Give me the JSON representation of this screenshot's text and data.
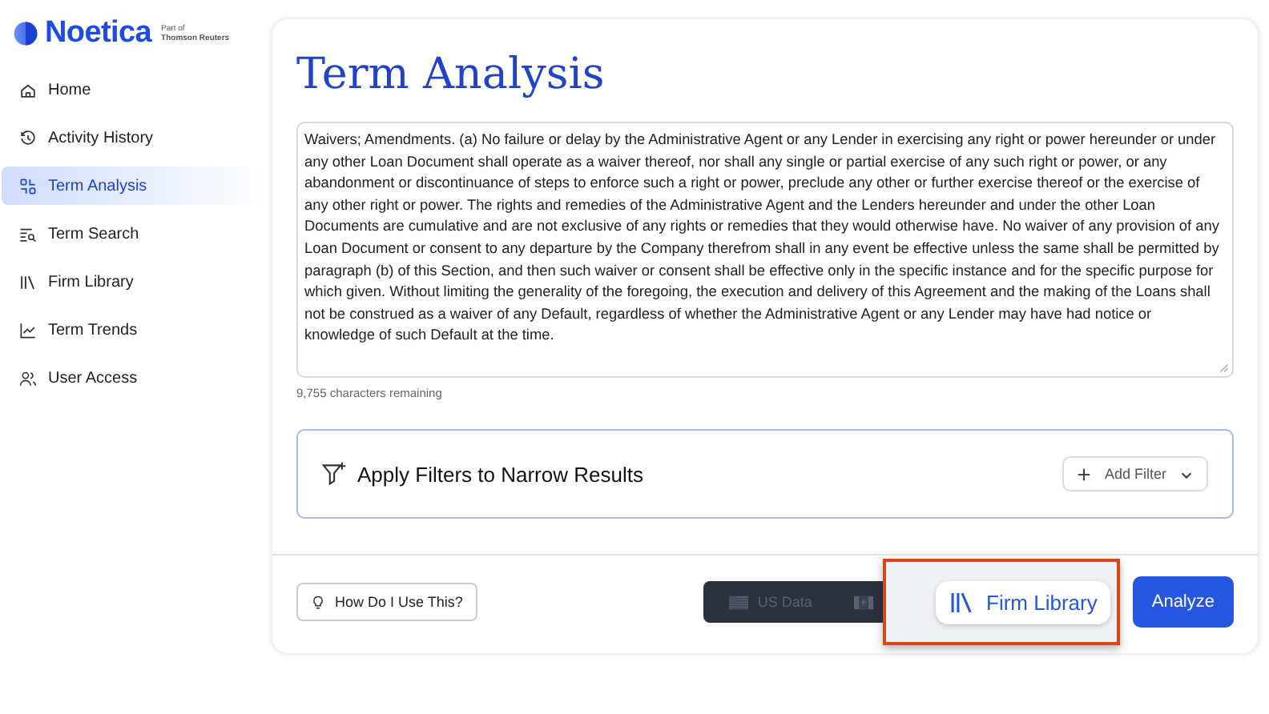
{
  "logo": {
    "name": "Noetica",
    "tagline_1": "Part of",
    "tagline_2": "Thomson Reuters"
  },
  "sidebar": {
    "items": [
      {
        "label": "Home",
        "selected": false
      },
      {
        "label": "Activity History",
        "selected": false
      },
      {
        "label": "Term Analysis",
        "selected": true
      },
      {
        "label": "Term Search",
        "selected": false
      },
      {
        "label": "Firm Library",
        "selected": false
      },
      {
        "label": "Term Trends",
        "selected": false
      },
      {
        "label": "User Access",
        "selected": false
      }
    ]
  },
  "page": {
    "title": "Term Analysis",
    "text_input": {
      "value": "Waivers; Amendments. (a) No failure or delay by the Administrative Agent or any Lender in exercising any right or power hereunder or under any other Loan Document shall operate as a waiver thereof, nor shall any single or partial exercise of any such right or power, or any abandonment or discontinuance of steps to enforce such a right or power, preclude any other or further exercise thereof or the exercise of any other right or power. The rights and remedies of the Administrative Agent and the Lenders hereunder and under the other Loan Documents are cumulative and are not exclusive of any rights or remedies that they would otherwise have. No waiver of any provision of any Loan Document or consent to any departure by the Company therefrom shall in any event be effective unless the same shall be permitted by paragraph (b) of this Section, and then such waiver or consent shall be effective only in the specific instance and for the specific purpose for which given. Without limiting the generality of the foregoing, the execution and delivery of this Agreement and the making of the Loans shall not be construed as a waiver of any Default, regardless of whether the Administrative Agent or any Lender may have had notice or knowledge of such Default at the time.",
      "counter": "9,755 characters remaining"
    },
    "filters": {
      "title": "Apply Filters to Narrow Results",
      "add_button": "Add Filter"
    },
    "footer": {
      "help_button": "How Do I Use This?",
      "data_toggle_label": "US Data",
      "highlight_button": "Firm Library",
      "analyze_button": "Analyze"
    }
  }
}
